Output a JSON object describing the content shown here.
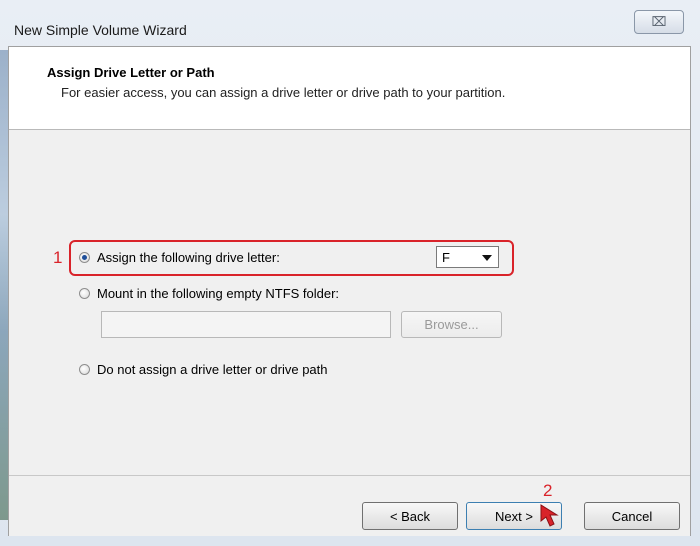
{
  "window": {
    "title": "New Simple Volume Wizard",
    "close_glyph": "⌧"
  },
  "header": {
    "title": "Assign Drive Letter or Path",
    "subtitle": "For easier access, you can assign a drive letter or drive path to your partition."
  },
  "options": {
    "assign_letter_label": "Assign the following drive letter:",
    "assign_letter_selected": true,
    "drive_letter_value": "F",
    "mount_folder_label": "Mount in the following empty NTFS folder:",
    "folder_path_value": "",
    "browse_label": "Browse...",
    "no_assign_label": "Do not assign a drive letter or drive path"
  },
  "annotations": {
    "marker_1": "1",
    "marker_2": "2",
    "color": "#d9232a"
  },
  "footer": {
    "back_label": "< Back",
    "next_label": "Next >",
    "cancel_label": "Cancel"
  }
}
